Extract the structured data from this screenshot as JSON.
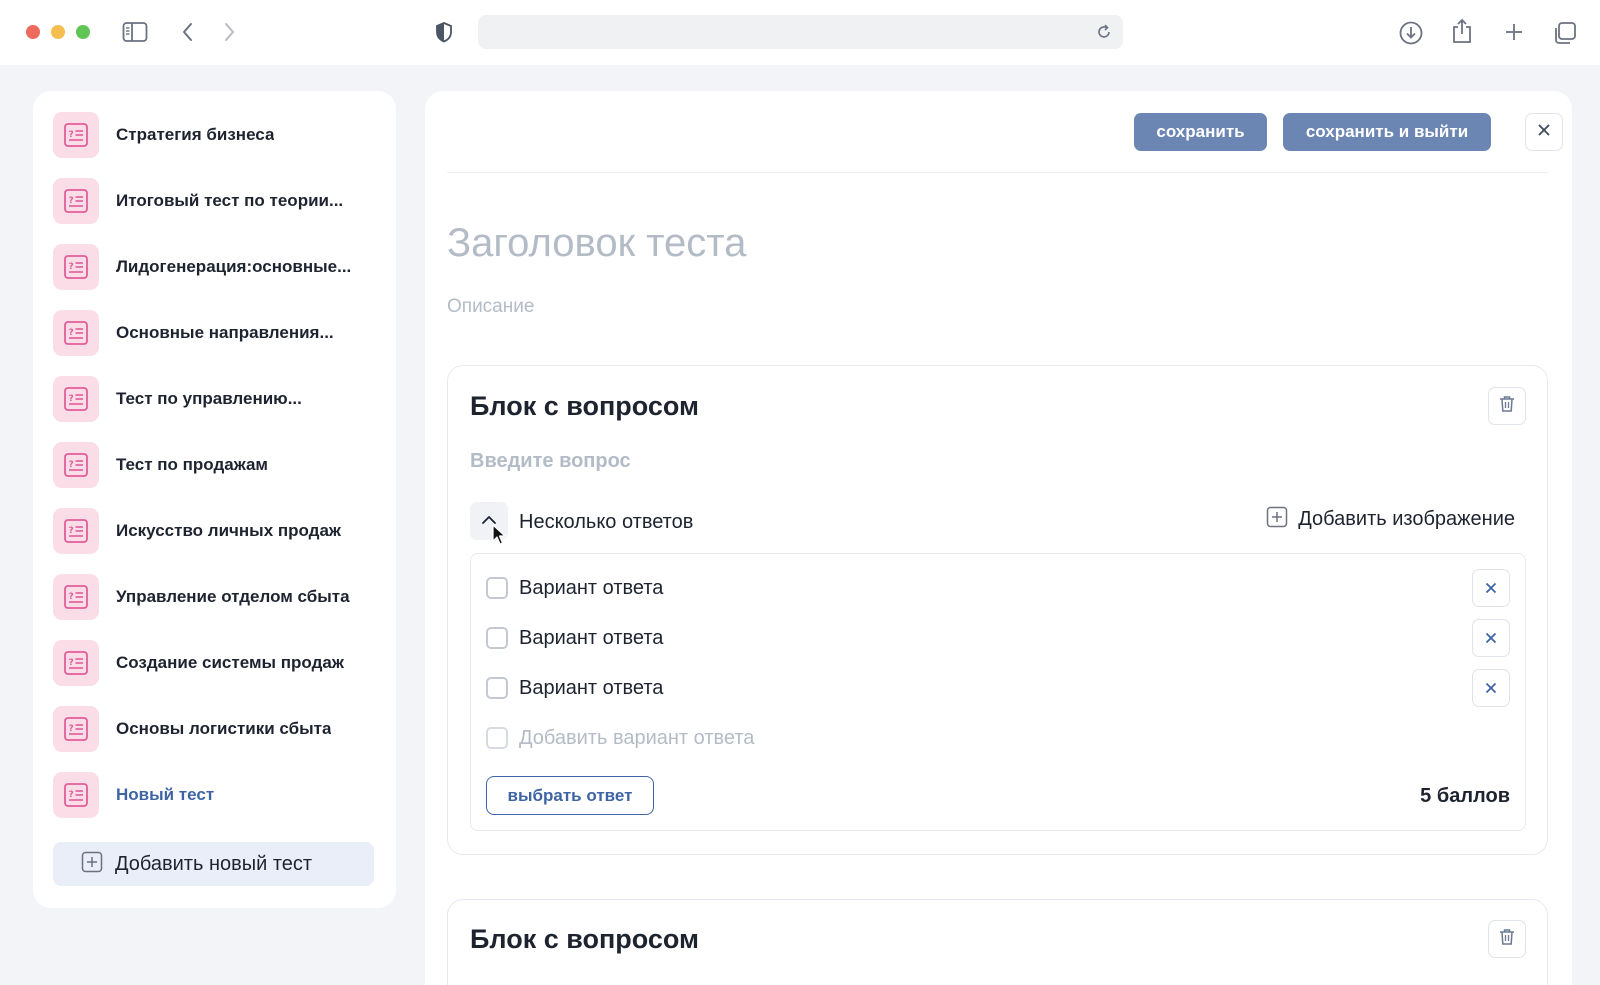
{
  "browser": {
    "url": "",
    "icons": [
      "sidebar-toggle-icon",
      "back-icon",
      "forward-icon",
      "shield-icon",
      "reload-icon",
      "download-icon",
      "share-icon",
      "new-tab-icon",
      "tabs-overview-icon"
    ]
  },
  "sidebar": {
    "items": [
      {
        "label": "Стратегия бизнеса",
        "active": false
      },
      {
        "label": "Итоговый тест по теории...",
        "active": false
      },
      {
        "label": "Лидогенерация:основные...",
        "active": false
      },
      {
        "label": "Основные направления...",
        "active": false
      },
      {
        "label": "Тест по управлению...",
        "active": false
      },
      {
        "label": "Тест по продажам",
        "active": false
      },
      {
        "label": "Искусство личных продаж",
        "active": false
      },
      {
        "label": "Управление отделом сбыта",
        "active": false
      },
      {
        "label": "Создание системы продаж",
        "active": false
      },
      {
        "label": "Основы логистики сбыта",
        "active": false
      },
      {
        "label": "Новый тест",
        "active": true
      }
    ],
    "add_label": "Добавить новый тест"
  },
  "toolbar": {
    "save_label": "сохранить",
    "save_exit_label": "сохранить и выйти"
  },
  "test": {
    "title_placeholder": "Заголовок теста",
    "description_placeholder": "Описание"
  },
  "blocks": [
    {
      "title": "Блок с вопросом",
      "question_placeholder": "Введите вопрос",
      "answer_type": "Несколько ответов",
      "add_image_label": "Добавить изображение",
      "answers": [
        "Вариант ответа",
        "Вариант ответа",
        "Вариант ответа"
      ],
      "add_answer_placeholder": "Добавить вариант ответа",
      "choose_answer_label": "выбрать ответ",
      "points": "5 баллов"
    },
    {
      "title": "Блок с вопросом"
    }
  ],
  "colors": {
    "accent": "#3e64a5",
    "button": "#6c86b4",
    "icon_pink": "#e25d9a",
    "icon_bg": "#fbdde8",
    "placeholder": "#b3bcc6"
  }
}
